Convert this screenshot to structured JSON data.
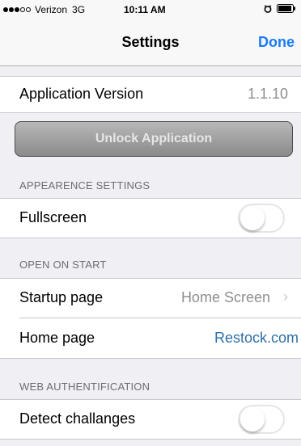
{
  "status_bar": {
    "carrier": "Verizon",
    "network": "3G",
    "time": "10:11 AM"
  },
  "nav": {
    "title": "Settings",
    "done_label": "Done"
  },
  "app_version": {
    "label": "Application Version",
    "value": "1.1.10"
  },
  "unlock_button_label": "Unlock Application",
  "sections": {
    "appearance": {
      "header": "APPEARENCE SETTINGS",
      "fullscreen_label": "Fullscreen",
      "fullscreen_on": false
    },
    "open_on_start": {
      "header": "OPEN ON START",
      "startup_label": "Startup page",
      "startup_value": "Home Screen",
      "home_label": "Home page",
      "home_value": "Restock.com"
    },
    "web_auth": {
      "header": "WEB AUTHENTIFICATION",
      "detect_label": "Detect challanges",
      "detect_on": false
    }
  },
  "colors": {
    "accent": "#1a7cf5",
    "link_value": "#2d6fa8",
    "background": "#efeff4"
  }
}
